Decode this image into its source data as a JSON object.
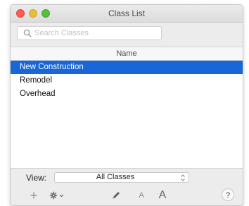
{
  "window": {
    "title": "Class List"
  },
  "search": {
    "placeholder": "Search Classes"
  },
  "table": {
    "column_header": "Name",
    "rows": [
      {
        "label": "New Construction",
        "selected": true
      },
      {
        "label": "Remodel",
        "selected": false
      },
      {
        "label": "Overhead",
        "selected": false
      }
    ]
  },
  "footer": {
    "view_label": "View:",
    "view_value": "All Classes",
    "font_small": "A",
    "font_large": "A",
    "help": "?"
  },
  "icons": {
    "add": "plus-icon",
    "settings": "gear-icon",
    "edit": "pencil-icon",
    "search": "search-icon"
  },
  "colors": {
    "selection": "#1866d8",
    "close": "#fc5b57",
    "minimize": "#e5bf3c",
    "maximize": "#57c038"
  }
}
